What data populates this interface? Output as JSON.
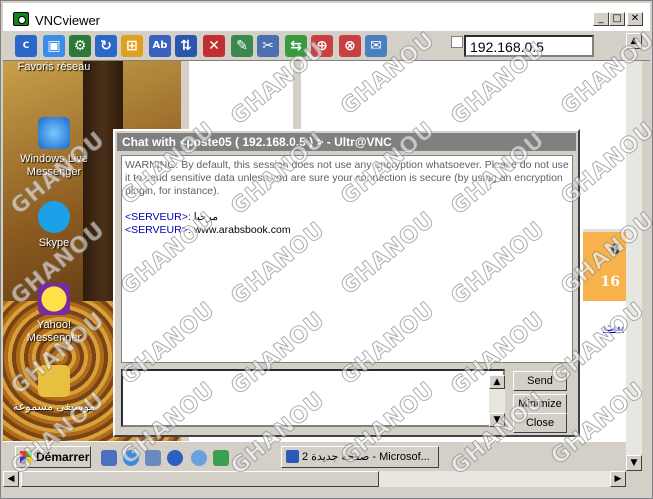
{
  "window": {
    "title": "VNCviewer",
    "controls": {
      "minimize": "_",
      "maximize": "□",
      "close": "✕"
    }
  },
  "toolbar": {
    "address": "192.168.0.5",
    "icons": [
      "cad-icon",
      "fullscreen-icon",
      "options-icon",
      "refresh-icon",
      "windows-icon",
      "abc-icon",
      "transfer-icon",
      "stop-icon",
      "tools-icon",
      "filetransfer-icon",
      "zoom-icon",
      "network-icon",
      "chat-icon"
    ]
  },
  "desktop": {
    "icons": [
      {
        "label": "Favoris réseau"
      },
      {
        "label": "Windows Live Messenger"
      },
      {
        "label": "Skype"
      },
      {
        "label": "Yahoo! Messenger"
      },
      {
        "label": "موسيقى مسموعة"
      }
    ]
  },
  "remote_page": {
    "numbers": [
      "6",
      "16"
    ],
    "link_fragment": "بيت"
  },
  "taskbar": {
    "start_label": "Démarrer",
    "task_label": "2 صفحة جديدة - Microsof..."
  },
  "chat": {
    "title": "Chat with <poste05 ( 192.168.0.5 ) > - Ultr@VNC",
    "warning": "WARNING: By default, this session does not use any encryption whatsoever. Please do not use it to send sensitive data unless you are sure your connection is secure (by using an encryption plugin, for instance).",
    "messages": [
      {
        "sender": "<SERVEUR>",
        "text": "مرحبا"
      },
      {
        "sender": "<SERVEUR>",
        "text": "www.arabsbook.com"
      }
    ],
    "buttons": {
      "send": "Send",
      "minimize": "Minimize",
      "close": "Close"
    }
  },
  "watermark": "GHANOU"
}
